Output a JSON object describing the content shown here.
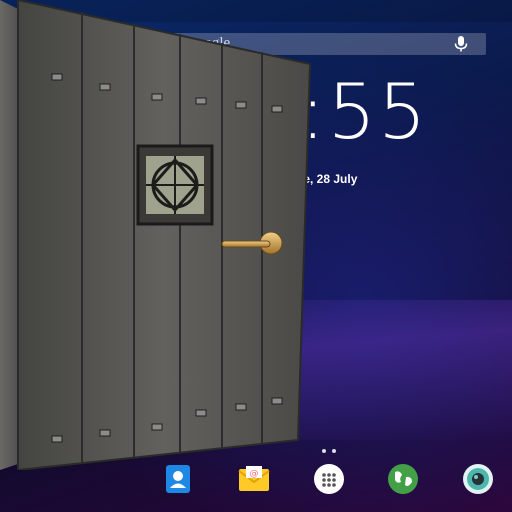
{
  "search": {
    "logo_text": "Google"
  },
  "clock": {
    "time": ":55",
    "date": "ue, 28 July"
  },
  "dock": [
    {
      "name": "contacts",
      "icon": "contacts-icon"
    },
    {
      "name": "email",
      "icon": "email-icon"
    },
    {
      "name": "app-drawer",
      "icon": "app-drawer-icon"
    },
    {
      "name": "browser",
      "icon": "globe-icon"
    },
    {
      "name": "camera",
      "icon": "camera-icon"
    }
  ],
  "colors": {
    "door": "#5b5a57",
    "door_dark": "#2f2f2d",
    "handle": "#c89a4b",
    "accent_blue": "#1e88e5"
  }
}
